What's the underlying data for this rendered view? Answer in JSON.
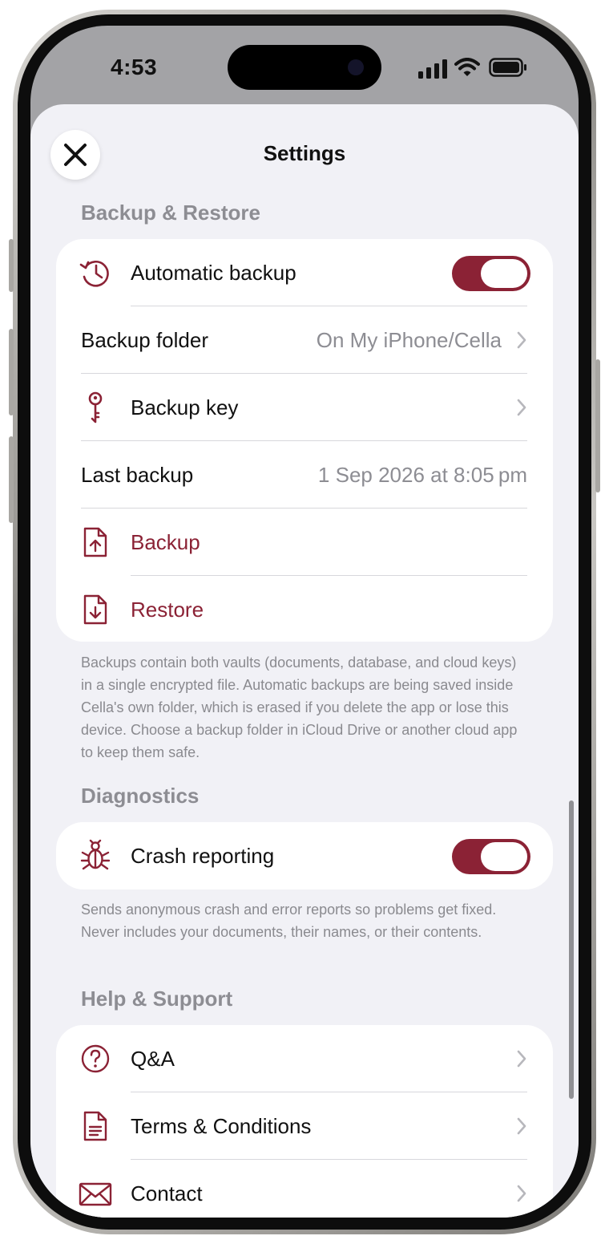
{
  "status_bar": {
    "time": "4:53"
  },
  "header": {
    "title": "Settings",
    "close_icon": "close-icon"
  },
  "colors": {
    "accent": "#8b2235",
    "background": "#f1f1f6",
    "card": "#ffffff",
    "secondary_text": "#8d8d93"
  },
  "backup_section": {
    "header": "Backup & Restore",
    "automatic_backup": {
      "label": "Automatic backup",
      "icon": "clock-history-icon",
      "enabled": true
    },
    "backup_folder": {
      "label": "Backup folder",
      "value": "On My iPhone/Cella"
    },
    "backup_key": {
      "label": "Backup key",
      "icon": "key-icon"
    },
    "last_backup": {
      "label": "Last backup",
      "value": "1 Sep 2026 at 8:05 pm"
    },
    "backup_action": {
      "label": "Backup",
      "icon": "document-upload-icon"
    },
    "restore_action": {
      "label": "Restore",
      "icon": "document-download-icon"
    },
    "footer": "Backups contain both vaults (documents, database, and cloud keys) in a single encrypted file. Automatic backups are being saved inside Cella's own folder, which is erased if you delete the app or lose this device. Choose a backup folder in iCloud Drive or another cloud app to keep them safe."
  },
  "diagnostics_section": {
    "header": "Diagnostics",
    "crash_reporting": {
      "label": "Crash reporting",
      "icon": "bug-icon",
      "enabled": true
    },
    "footer": "Sends anonymous crash and error reports so problems get fixed. Never includes your documents, their names, or their contents."
  },
  "help_section": {
    "header": "Help & Support",
    "items": [
      {
        "label": "Q&A",
        "icon": "question-circle-icon"
      },
      {
        "label": "Terms & Conditions",
        "icon": "document-text-icon"
      },
      {
        "label": "Contact",
        "icon": "envelope-icon"
      }
    ]
  }
}
